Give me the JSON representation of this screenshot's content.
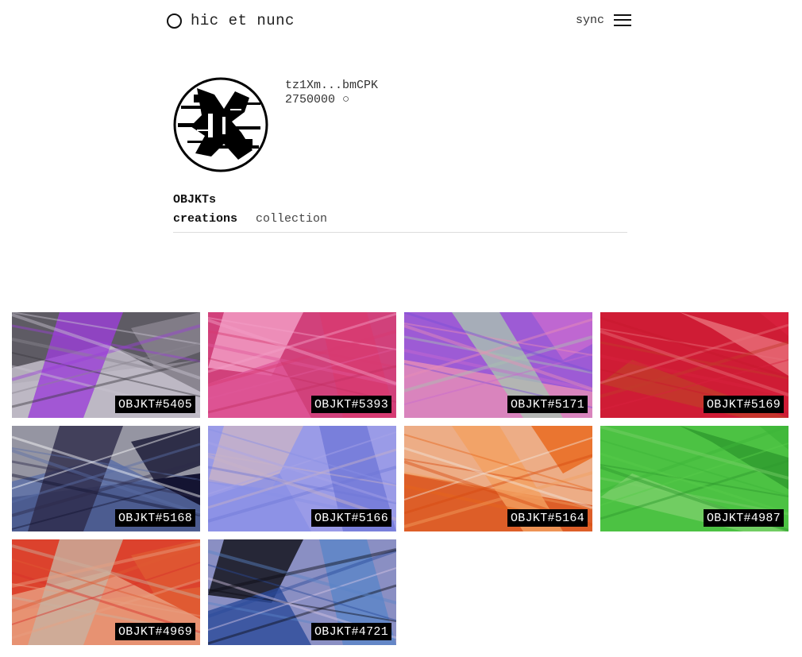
{
  "header": {
    "logo_text": "hic et nunc",
    "sync_label": "sync",
    "logo-icon": "circle-outline-icon",
    "menu-icon": "hamburger-menu-icon"
  },
  "profile": {
    "wallet": "tz1Xm...bmCPK",
    "balance": "2750000 ○"
  },
  "section": {
    "title": "OBJKTs",
    "tabs": [
      {
        "label": "creations",
        "active": true
      },
      {
        "label": "collection",
        "active": false
      }
    ]
  },
  "objkts": [
    {
      "label": "OBJKT#5405",
      "colors": [
        "#8a8590",
        "#3b3940",
        "#c9c4d1",
        "#9b3fd8"
      ]
    },
    {
      "label": "OBJKT#5393",
      "colors": [
        "#e0589a",
        "#c43063",
        "#f4a0c8",
        "#d83a70"
      ]
    },
    {
      "label": "OBJKT#5171",
      "colors": [
        "#c86ad0",
        "#7a4ed8",
        "#e98fb6",
        "#a9c2b0"
      ]
    },
    {
      "label": "OBJKT#5169",
      "colors": [
        "#d8223e",
        "#c8182e",
        "#e8707a",
        "#c23b2a"
      ]
    },
    {
      "label": "OBJKT#5168",
      "colors": [
        "#141432",
        "#ffffff",
        "#5a6ea8",
        "#2d2a4a"
      ]
    },
    {
      "label": "OBJKT#5166",
      "colors": [
        "#8a90e6",
        "#a8a4e8",
        "#c9b3c7",
        "#7078d8"
      ]
    },
    {
      "label": "OBJKT#5164",
      "colors": [
        "#e8661a",
        "#f0e8e0",
        "#d84a10",
        "#f3a060"
      ]
    },
    {
      "label": "OBJKT#4987",
      "colors": [
        "#3eb63a",
        "#58cc4a",
        "#2e9a2e",
        "#7ad06a"
      ]
    },
    {
      "label": "OBJKT#4969",
      "colors": [
        "#e05a32",
        "#d8302a",
        "#e8a082",
        "#c9b2a0"
      ]
    },
    {
      "label": "OBJKT#4721",
      "colors": [
        "#2a4a9a",
        "#d8c8e6",
        "#0c0c14",
        "#5a84c8"
      ]
    }
  ]
}
